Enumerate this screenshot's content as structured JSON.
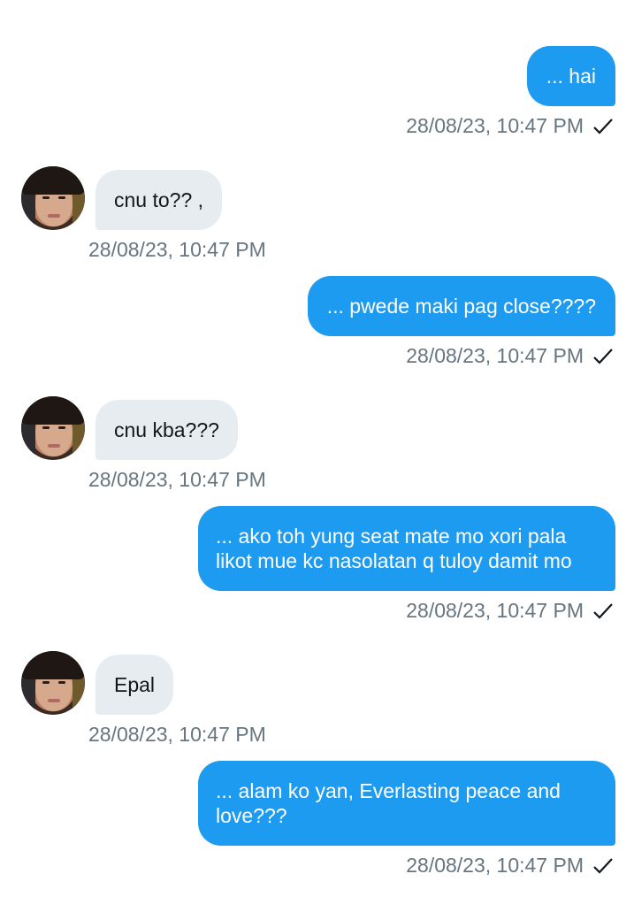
{
  "messages": [
    {
      "direction": "sent",
      "text": "... hai",
      "time": "28/08/23, 10:47 PM",
      "read_icon": "check-icon"
    },
    {
      "direction": "received",
      "text": "cnu to?? ,",
      "time": "28/08/23, 10:47 PM"
    },
    {
      "direction": "sent",
      "text": "... pwede maki pag close????",
      "time": "28/08/23, 10:47 PM",
      "read_icon": "check-icon"
    },
    {
      "direction": "received",
      "text": "cnu kba???",
      "time": "28/08/23, 10:47 PM"
    },
    {
      "direction": "sent",
      "text": "... ako toh yung seat mate mo xori pala likot mue kc nasolatan q tuloy damit mo",
      "time": "28/08/23, 10:47 PM",
      "read_icon": "check-icon"
    },
    {
      "direction": "received",
      "text": "Epal",
      "time": "28/08/23, 10:47 PM"
    },
    {
      "direction": "sent",
      "text": "... alam ko yan, Everlasting peace and love???",
      "time": "28/08/23, 10:47 PM",
      "read_icon": "check-icon"
    }
  ],
  "colors": {
    "sent_bubble": "#1d9bf0",
    "received_bubble": "#e6ecf0",
    "timestamp": "#66757f",
    "sent_text": "#ffffff",
    "received_text": "#14171a"
  },
  "icons": {
    "read_receipt": "check-icon",
    "avatar": "avatar"
  }
}
